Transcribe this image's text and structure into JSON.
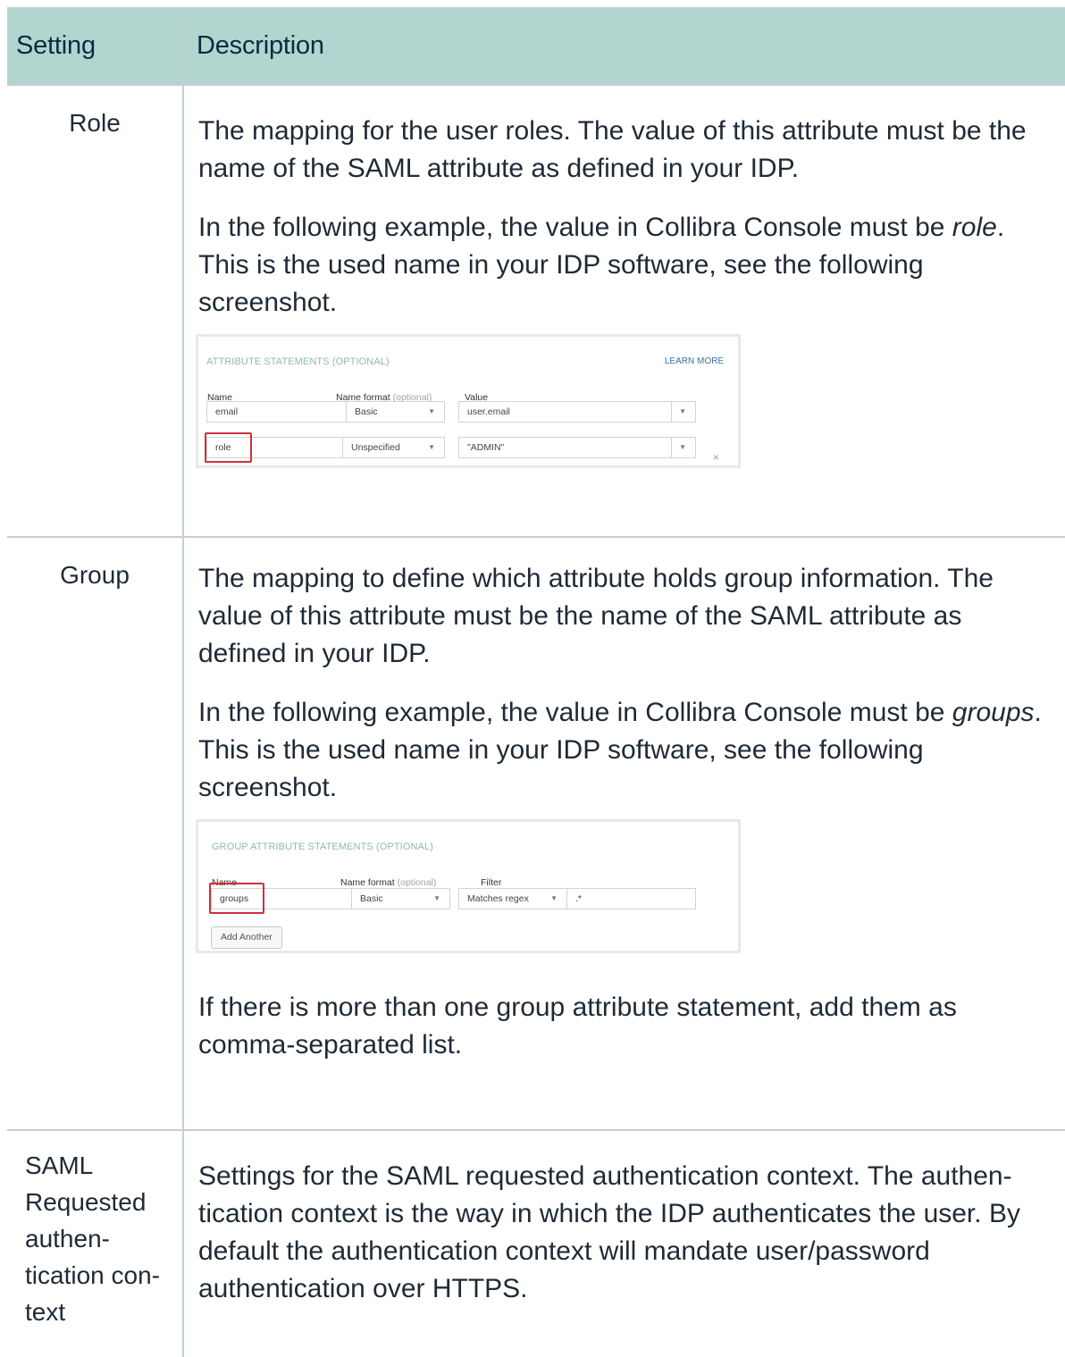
{
  "table": {
    "headers": {
      "setting": "Setting",
      "description": "Description"
    },
    "rows": {
      "role": {
        "setting": "Role",
        "p1": "The mapping for the user roles. The value of this attribute must be the name of the SAML attribute as defined in your IDP.",
        "p2_pre": "In the following example, the value in Collibra Console must be ",
        "p2_em": "role",
        "p2_post": ". This is the used name in your IDP software, see the following screenshot."
      },
      "group": {
        "setting": "Group",
        "p1": "The mapping to define which attribute holds group information. The value of this attribute must be the name of the SAML attribute as defined in your IDP.",
        "p2_pre": "In the following example, the value in Collibra Console must be ",
        "p2_em": "groups",
        "p2_post": ". This is the used name in your IDP software, see the following screenshot.",
        "p3": "If there is more than one group attribute statement, add them as comma-separated list."
      },
      "saml": {
        "setting_lines": [
          "SAML",
          "Requested",
          "authen-",
          "tication con-",
          "text"
        ],
        "p1": "Settings for the SAML requested authentication context. The authen-tication context is the way in which the IDP authenticates the user. By default the authentication context will mandate user/password authentication over HTTPS."
      }
    }
  },
  "screenshot_attributes": {
    "section_title": "ATTRIBUTE STATEMENTS (OPTIONAL)",
    "learn_more": "LEARN MORE",
    "col_name": "Name",
    "col_format": "Name format",
    "col_format_optional": "(optional)",
    "col_value": "Value",
    "rows": [
      {
        "name": "email",
        "format": "Basic",
        "value": "user.email"
      },
      {
        "name": "role",
        "format": "Unspecified",
        "value": "\"ADMIN\""
      }
    ],
    "remove_glyph": "×"
  },
  "screenshot_groups": {
    "section_title": "GROUP ATTRIBUTE STATEMENTS (OPTIONAL)",
    "col_name": "Name",
    "col_format": "Name format",
    "col_format_optional": "(optional)",
    "col_filter": "Filter",
    "row": {
      "name": "groups",
      "format": "Basic",
      "filter_type": "Matches regex",
      "filter_value": ".*"
    },
    "add_button": "Add Another"
  },
  "colors": {
    "header_bg": "#b2d6cf",
    "border": "#c6cdd3",
    "highlight": "#d0303a",
    "section_title": "#8fb9aa",
    "link": "#3c6fa3"
  }
}
